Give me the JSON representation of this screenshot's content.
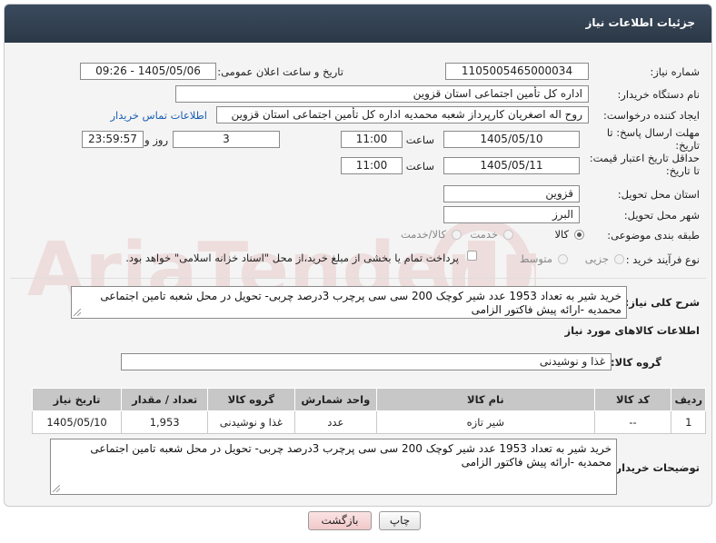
{
  "header": {
    "title": "جزئیات اطلاعات نیاز"
  },
  "fields": {
    "need_number_label": "شماره نیاز:",
    "need_number": "1105005465000034",
    "announce_label": "تاریخ و ساعت اعلان عمومی:",
    "announce_value": "1405/05/06 - 09:26",
    "buyer_org_label": "نام دستگاه خریدار:",
    "buyer_org": "اداره کل تأمین اجتماعی استان قزوین",
    "creator_label": "ایجاد کننده درخواست:",
    "creator": "روح اله اصغریان کارپرداز شعبه محمدیه  اداره کل تأمین اجتماعی استان قزوین",
    "contact_link": "اطلاعات تماس خریدار",
    "deadline_label": "مهلت ارسال پاسخ: تا تاریخ:",
    "deadline_date": "1405/05/10",
    "time_label": "ساعت",
    "deadline_time": "11:00",
    "days_value": "3",
    "days_label": "روز و",
    "remaining_time": "23:59:57",
    "remaining_label": "ساعت باقی مانده",
    "price_label": "حداقل تاریخ اعتبار قیمت: تا تاریخ:",
    "price_date": "1405/05/11",
    "price_time": "11:00",
    "province_label": "استان محل تحویل:",
    "province": "قزوین",
    "city_label": "شهر محل تحویل:",
    "city": "البرز",
    "category_label": "طبقه بندی موضوعی:",
    "category_options": [
      "کالا",
      "خدمت",
      "کالا/خدمت"
    ],
    "process_label": "نوع فرآیند خرید :",
    "process_options": [
      "جزیی",
      "متوسط"
    ],
    "payment_note": "پرداخت تمام یا بخشی از مبلغ خرید،از محل \"اسناد خزانه اسلامی\" خواهد بود."
  },
  "description": {
    "label": "شرح کلی نیاز:",
    "text": "خرید شیر به تعداد 1953 عدد شیر کوچک 200 سی سی پرچرب 3درصد چربی- تحویل در محل شعبه تامین اجتماعی محمدیه -ارائه پیش فاکتور الزامی"
  },
  "goods": {
    "section_title": "اطلاعات کالاهای مورد نیاز",
    "group_label": "گروه کالا:",
    "group_value": "غذا و نوشیدنی",
    "columns": [
      "ردیف",
      "کد کالا",
      "نام کالا",
      "واحد شمارش",
      "گروه کالا",
      "تعداد / مقدار",
      "تاریخ نیاز"
    ],
    "rows": [
      {
        "row": "1",
        "code": "--",
        "name": "شیر تازه",
        "unit": "عدد",
        "group": "غذا و نوشیدنی",
        "qty": "1,953",
        "date": "1405/05/10"
      }
    ]
  },
  "buyer_notes": {
    "label": "توضیحات خریدار:",
    "text": "خرید شیر به تعداد 1953 عدد شیر کوچک 200 سی سی پرچرب 3درصد چربی- تحویل در محل شعبه تامین اجتماعی محمدیه -ارائه پیش فاکتور الزامی"
  },
  "buttons": {
    "print": "چاپ",
    "back": "بازگشت"
  },
  "watermark_text": "AriaTender.net",
  "colors": {
    "header_bg": "#2f3d4c",
    "link": "#1a5fb4",
    "back_button": "#f7d6d6"
  }
}
